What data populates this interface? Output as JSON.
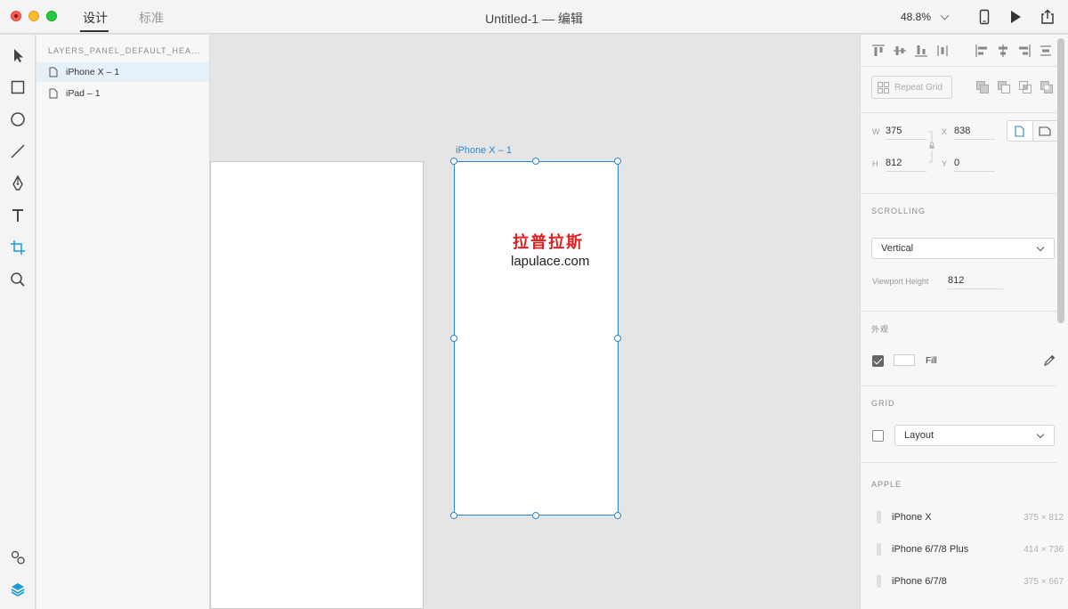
{
  "window": {
    "mode_tabs": {
      "design": "设计",
      "prototype": "标准"
    },
    "document_title": "Untitled-1 — 编辑",
    "zoom": "48.8%"
  },
  "layers_panel": {
    "header": "LAYERS_PANEL_DEFAULT_HEA...",
    "items": [
      {
        "label": "iPhone X – 1",
        "selected": true
      },
      {
        "label": "iPad – 1",
        "selected": false
      }
    ]
  },
  "canvas": {
    "artboard_label": "iPhone X – 1",
    "watermark_cn": "拉普拉斯",
    "watermark_en": "lapulace.com"
  },
  "inspector": {
    "repeat_grid_label": "Repeat Grid",
    "w_label": "W",
    "w_value": "375",
    "h_label": "H",
    "h_value": "812",
    "x_label": "X",
    "x_value": "838",
    "y_label": "Y",
    "y_value": "0",
    "scrolling": {
      "title": "SCROLLING",
      "mode": "Vertical",
      "viewport_label": "Viewport Height",
      "viewport_value": "812"
    },
    "appearance": {
      "title": "外观",
      "fill_label": "Fill",
      "fill_checked": true,
      "fill_color": "#ffffff"
    },
    "grid": {
      "title": "GRID",
      "type": "Layout",
      "checked": false
    },
    "apple": {
      "title": "APPLE",
      "devices": [
        {
          "name": "iPhone X",
          "size": "375 × 812"
        },
        {
          "name": "iPhone 6/7/8 Plus",
          "size": "414 × 736"
        },
        {
          "name": "iPhone 6/7/8",
          "size": "375 × 667"
        }
      ]
    }
  },
  "colors": {
    "selection": "#2e86c9",
    "watermark_red": "#e02020",
    "active_tool": "#1a9bd6"
  }
}
